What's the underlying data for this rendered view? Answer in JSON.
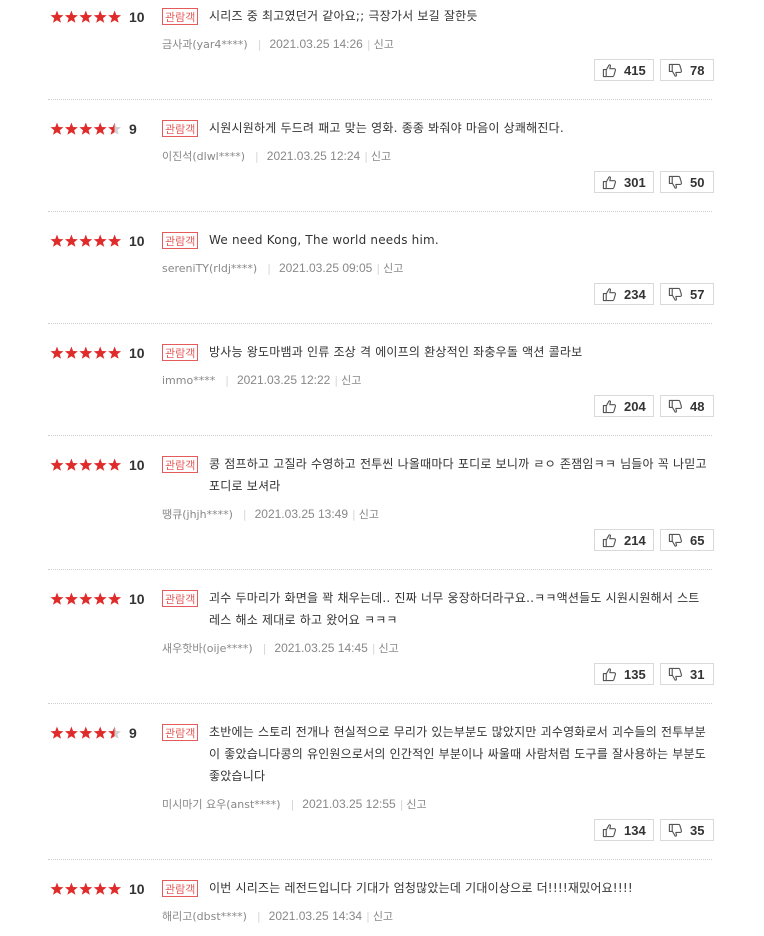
{
  "colors": {
    "star": "#e02b2b",
    "star_empty": "#cfcfcf",
    "badge": "#e55b5b"
  },
  "reviews": [
    {
      "score": "10",
      "rating": 10,
      "badge": "관람객",
      "text": "시리즈 중 최고였던거 같아요;; 극장가서 보길 잘한듯",
      "author": "금사과(yar4****)",
      "date": "2021.03.25 14:26",
      "report": "신고",
      "likes": "415",
      "dislikes": "78"
    },
    {
      "score": "9",
      "rating": 9,
      "badge": "관람객",
      "text": "시원시원하게 두드려 패고 맞는 영화. 종종 봐줘야 마음이 상쾌해진다.",
      "author": "이진석(dlwl****)",
      "date": "2021.03.25 12:24",
      "report": "신고",
      "likes": "301",
      "dislikes": "50"
    },
    {
      "score": "10",
      "rating": 10,
      "badge": "관람객",
      "text": "We need Kong, The world needs him.",
      "author": "sereniTY(rldj****)",
      "date": "2021.03.25 09:05",
      "report": "신고",
      "likes": "234",
      "dislikes": "57"
    },
    {
      "score": "10",
      "rating": 10,
      "badge": "관람객",
      "text": "방사능 왕도마뱀과 인류 조상 격 에이프의 환상적인 좌충우돌 액션 콜라보",
      "author": "immo****",
      "date": "2021.03.25 12:22",
      "report": "신고",
      "likes": "204",
      "dislikes": "48"
    },
    {
      "score": "10",
      "rating": 10,
      "badge": "관람객",
      "text": "콩 점프하고 고질라 수영하고 전투씬 나올때마다 포디로 보니까 ㄹㅇ 존잼임ㅋㅋ 님들아 꼭 나믿고 포디로 보셔라",
      "author": "땡큐(jhjh****)",
      "date": "2021.03.25 13:49",
      "report": "신고",
      "likes": "214",
      "dislikes": "65"
    },
    {
      "score": "10",
      "rating": 10,
      "badge": "관람객",
      "text": "괴수 두마리가 화면을 꽉 채우는데.. 진짜 너무 웅장하더라구요..ㅋㅋ액션들도 시원시원해서 스트레스 해소 제대로 하고 왔어요 ㅋㅋㅋ",
      "author": "새우핫바(oije****)",
      "date": "2021.03.25 14:45",
      "report": "신고",
      "likes": "135",
      "dislikes": "31"
    },
    {
      "score": "9",
      "rating": 9,
      "badge": "관람객",
      "text": "초반에는 스토리 전개나 현실적으로 무리가 있는부분도 많았지만 괴수영화로서 괴수들의 전투부분이 좋았습니다콩의 유인원으로서의 인간적인 부분이나 싸울때 사람처럼 도구를 잘사용하는 부분도 좋았습니다",
      "author": "미시마기 요우(anst****)",
      "date": "2021.03.25 12:55",
      "report": "신고",
      "likes": "134",
      "dislikes": "35"
    },
    {
      "score": "10",
      "rating": 10,
      "badge": "관람객",
      "text": "이번 시리즈는 레전드입니다 기대가 엄청많았는데 기대이상으로 더!!!!재밌어요!!!!",
      "author": "해리고(dbst****)",
      "date": "2021.03.25 14:34",
      "report": "신고",
      "likes": "",
      "dislikes": ""
    }
  ]
}
